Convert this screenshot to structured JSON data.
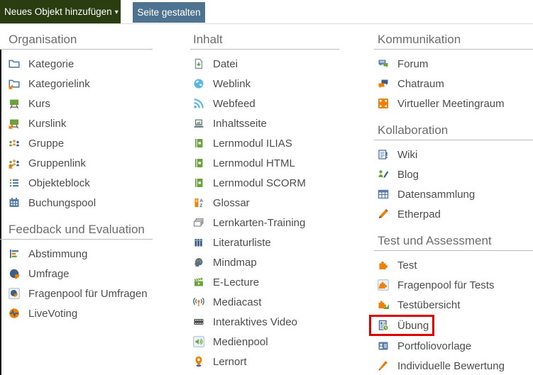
{
  "toolbar": {
    "new_object_button": "Neues Objekt hinzufügen",
    "caret_icon": "▾",
    "design_page_button": "Seite gestalten"
  },
  "colors": {
    "green_button": "#293d10",
    "blue_button": "#4e7390",
    "highlight_red": "#e00000",
    "icon_green": "#6ca23d",
    "icon_orange": "#ee8005",
    "icon_blue": "#567ca8",
    "icon_dark_blue": "#3f5e85",
    "icon_light_blue": "#55b7e8"
  },
  "menu": {
    "columns": [
      {
        "sections": [
          {
            "title": "Organisation",
            "items": [
              {
                "label": "Kategorie",
                "icon": "category-icon"
              },
              {
                "label": "Kategorielink",
                "icon": "category-link-icon"
              },
              {
                "label": "Kurs",
                "icon": "course-icon"
              },
              {
                "label": "Kurslink",
                "icon": "course-link-icon"
              },
              {
                "label": "Gruppe",
                "icon": "group-icon"
              },
              {
                "label": "Gruppenlink",
                "icon": "group-link-icon"
              },
              {
                "label": "Objekteblock",
                "icon": "item-group-icon"
              },
              {
                "label": "Buchungspool",
                "icon": "booking-pool-icon"
              }
            ]
          },
          {
            "title": "Feedback und Evaluation",
            "items": [
              {
                "label": "Abstimmung",
                "icon": "poll-icon"
              },
              {
                "label": "Umfrage",
                "icon": "survey-icon"
              },
              {
                "label": "Fragenpool für Umfragen",
                "icon": "survey-question-pool-icon"
              },
              {
                "label": "LiveVoting",
                "icon": "live-voting-icon"
              }
            ]
          }
        ]
      },
      {
        "sections": [
          {
            "title": "Inhalt",
            "items": [
              {
                "label": "Datei",
                "icon": "file-icon"
              },
              {
                "label": "Weblink",
                "icon": "weblink-icon"
              },
              {
                "label": "Webfeed",
                "icon": "webfeed-icon"
              },
              {
                "label": "Inhaltsseite",
                "icon": "content-page-icon"
              },
              {
                "label": "Lernmodul ILIAS",
                "icon": "learning-module-ilias-icon"
              },
              {
                "label": "Lernmodul HTML",
                "icon": "learning-module-html-icon"
              },
              {
                "label": "Lernmodul SCORM",
                "icon": "learning-module-scorm-icon"
              },
              {
                "label": "Glossar",
                "icon": "glossary-icon"
              },
              {
                "label": "Lernkarten-Training",
                "icon": "flashcard-training-icon"
              },
              {
                "label": "Literaturliste",
                "icon": "bibliography-icon"
              },
              {
                "label": "Mindmap",
                "icon": "mindmap-icon"
              },
              {
                "label": "E-Lecture",
                "icon": "e-lecture-icon"
              },
              {
                "label": "Mediacast",
                "icon": "mediacast-icon"
              },
              {
                "label": "Interaktives Video",
                "icon": "interactive-video-icon"
              },
              {
                "label": "Medienpool",
                "icon": "media-pool-icon"
              },
              {
                "label": "Lernort",
                "icon": "learning-location-icon"
              }
            ]
          }
        ]
      },
      {
        "sections": [
          {
            "title": "Kommunikation",
            "items": [
              {
                "label": "Forum",
                "icon": "forum-icon"
              },
              {
                "label": "Chatraum",
                "icon": "chat-room-icon"
              },
              {
                "label": "Virtueller Meetingraum",
                "icon": "meeting-room-icon"
              }
            ]
          },
          {
            "title": "Kollaboration",
            "items": [
              {
                "label": "Wiki",
                "icon": "wiki-icon"
              },
              {
                "label": "Blog",
                "icon": "blog-icon"
              },
              {
                "label": "Datensammlung",
                "icon": "data-collection-icon"
              },
              {
                "label": "Etherpad",
                "icon": "etherpad-icon"
              }
            ]
          },
          {
            "title": "Test und Assessment",
            "items": [
              {
                "label": "Test",
                "icon": "test-icon"
              },
              {
                "label": "Fragenpool für Tests",
                "icon": "test-question-pool-icon"
              },
              {
                "label": "Testübersicht",
                "icon": "test-overview-icon"
              },
              {
                "label": "Übung",
                "icon": "exercise-icon",
                "highlighted": true
              },
              {
                "label": "Portfoliovorlage",
                "icon": "portfolio-template-icon"
              },
              {
                "label": "Individuelle Bewertung",
                "icon": "individual-assessment-icon"
              }
            ]
          }
        ]
      }
    ]
  }
}
